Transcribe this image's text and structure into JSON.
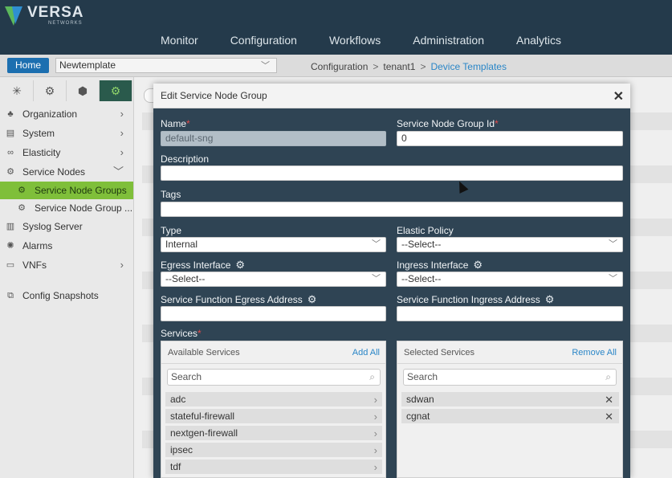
{
  "brand": {
    "name": "VERSA",
    "sub": "NETWORKS"
  },
  "topnav": [
    "Monitor",
    "Configuration",
    "Workflows",
    "Administration",
    "Analytics"
  ],
  "subbar": {
    "home": "Home",
    "template": "Newtemplate",
    "breadcrumb": {
      "c1": "Configuration",
      "sep": ">",
      "c2": "tenant1",
      "c3": "Device Templates"
    }
  },
  "sidebar": {
    "items": [
      {
        "label": "Organization",
        "icon": "org-icon"
      },
      {
        "label": "System",
        "icon": "system-icon"
      },
      {
        "label": "Elasticity",
        "icon": "elasticity-icon"
      },
      {
        "label": "Service Nodes",
        "icon": "service-nodes-icon"
      },
      {
        "label": "Service Node Groups",
        "icon": "gears-icon"
      },
      {
        "label": "Service Node Group ...",
        "icon": "gears-icon"
      },
      {
        "label": "Syslog Server",
        "icon": "syslog-icon"
      },
      {
        "label": "Alarms",
        "icon": "alarm-icon"
      },
      {
        "label": "VNFs",
        "icon": "vnf-icon"
      },
      {
        "label": "Config Snapshots",
        "icon": "snapshot-icon"
      }
    ]
  },
  "modal": {
    "title": "Edit Service Node Group",
    "name_label": "Name",
    "name_value": "default-sng",
    "id_label": "Service Node Group Id",
    "id_value": "0",
    "description_label": "Description",
    "description_value": "",
    "tags_label": "Tags",
    "tags_value": "",
    "type_label": "Type",
    "type_value": "Internal",
    "elastic_label": "Elastic Policy",
    "elastic_value": "--Select--",
    "egress_label": "Egress Interface",
    "egress_value": "--Select--",
    "ingress_label": "Ingress Interface",
    "ingress_value": "--Select--",
    "sf_egress_label": "Service Function Egress Address",
    "sf_egress_value": "",
    "sf_ingress_label": "Service Function Ingress Address",
    "sf_ingress_value": "",
    "services_label": "Services",
    "available": {
      "title": "Available Services",
      "action": "Add All",
      "search_placeholder": "Search",
      "items": [
        "adc",
        "stateful-firewall",
        "nextgen-firewall",
        "ipsec",
        "tdf"
      ]
    },
    "selected": {
      "title": "Selected Services",
      "action": "Remove All",
      "search_placeholder": "Search",
      "items": [
        "sdwan",
        "cgnat"
      ]
    }
  },
  "colors": {
    "header": "#243a4b",
    "modal": "#2f4454",
    "accent": "#7fbf3a",
    "link": "#2a86c7"
  }
}
